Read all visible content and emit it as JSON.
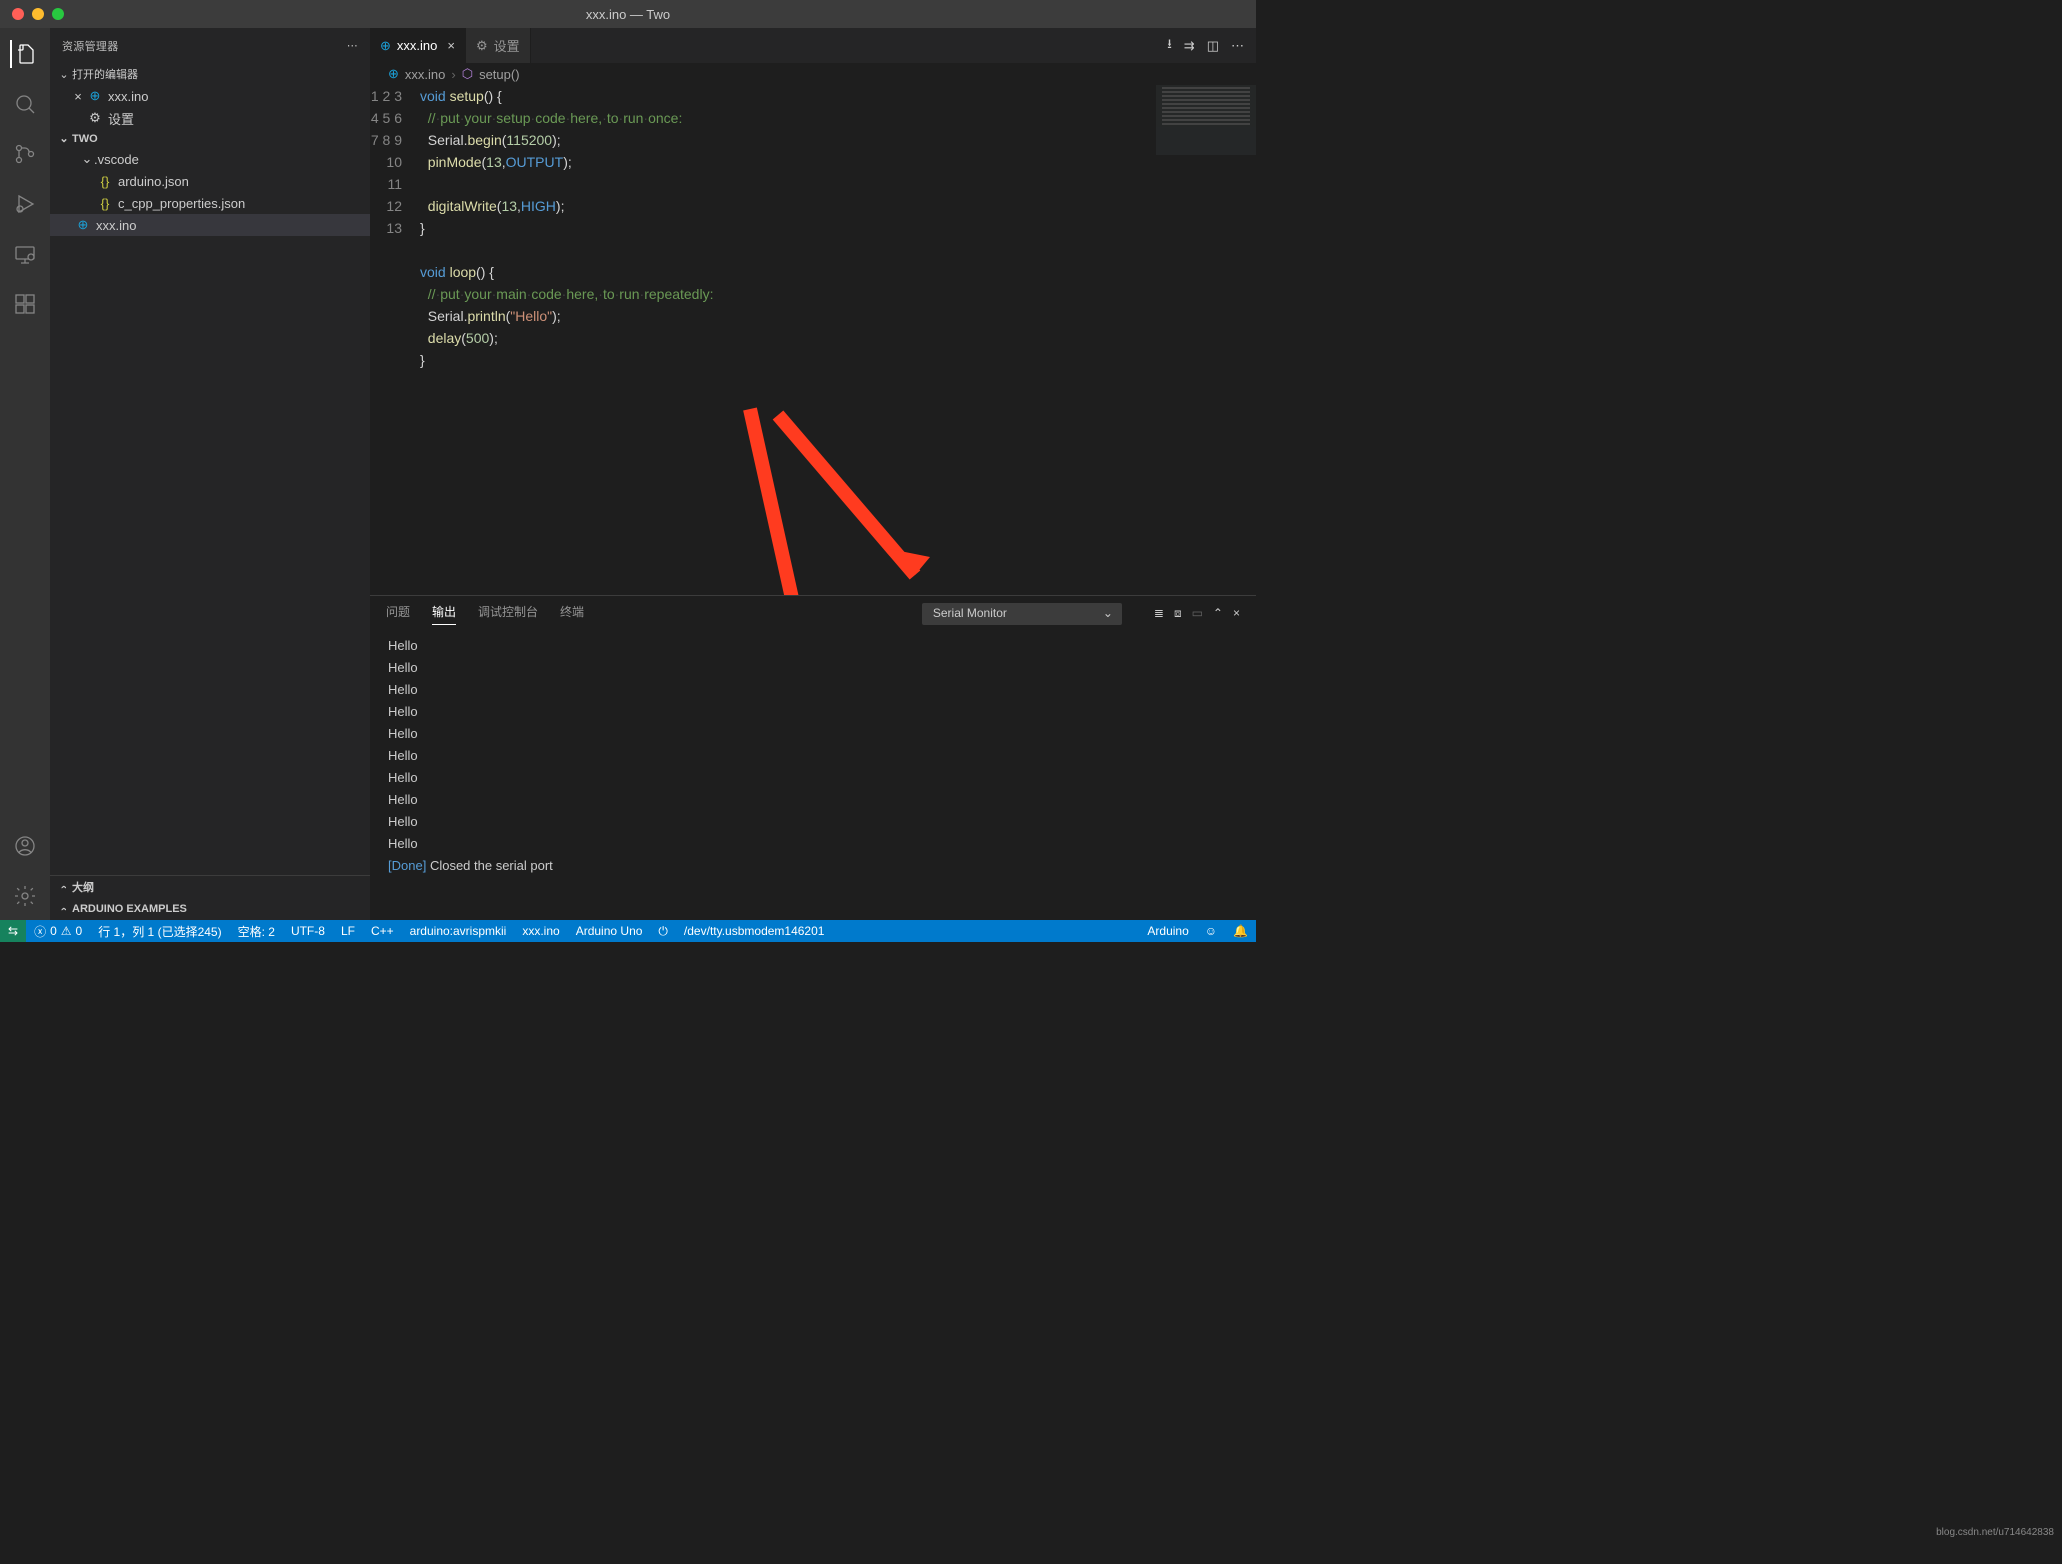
{
  "title": "xxx.ino — Two",
  "sidebar": {
    "title": "资源管理器",
    "open_editors": "打开的编辑器",
    "items": [
      {
        "icon": "arduino",
        "label": "xxx.ino",
        "closeable": true
      },
      {
        "icon": "gear",
        "label": "设置"
      }
    ],
    "workspace": "TWO",
    "tree": [
      {
        "type": "folder",
        "label": ".vscode"
      },
      {
        "type": "file",
        "icon": "json",
        "label": "arduino.json"
      },
      {
        "type": "file",
        "icon": "json",
        "label": "c_cpp_properties.json"
      },
      {
        "type": "file",
        "icon": "arduino",
        "label": "xxx.ino",
        "active": true
      }
    ],
    "panels": [
      "大纲",
      "ARDUINO EXAMPLES"
    ]
  },
  "tabs": [
    {
      "icon": "arduino",
      "label": "xxx.ino",
      "active": true,
      "closeable": true
    },
    {
      "icon": "gear",
      "label": "设置",
      "active": false
    }
  ],
  "breadcrumb": {
    "file": "xxx.ino",
    "symbol": "setup()"
  },
  "code": {
    "lines": [
      1,
      2,
      3,
      4,
      5,
      6,
      7,
      8,
      9,
      10,
      11,
      12,
      13
    ]
  },
  "panel": {
    "tabs": [
      "问题",
      "输出",
      "调试控制台",
      "终端"
    ],
    "active_tab": "输出",
    "select": "Serial Monitor",
    "output_lines": [
      "Hello",
      "Hello",
      "Hello",
      "Hello",
      "Hello",
      "Hello",
      "Hello",
      "Hello",
      "Hello",
      "Hello"
    ],
    "done_label": "[Done]",
    "done_msg": "Closed the serial port"
  },
  "status": {
    "errors": "0",
    "warnings": "0",
    "cursor": "行 1，列 1 (已选择245)",
    "spaces": "空格: 2",
    "encoding": "UTF-8",
    "eol": "LF",
    "lang": "C++",
    "programmer": "arduino:avrispmkii",
    "sketch": "xxx.ino",
    "board": "Arduino Uno",
    "port": "/dev/tty.usbmodem146201",
    "arduino": "Arduino"
  },
  "watermark": "blog.csdn.net/u714642838"
}
